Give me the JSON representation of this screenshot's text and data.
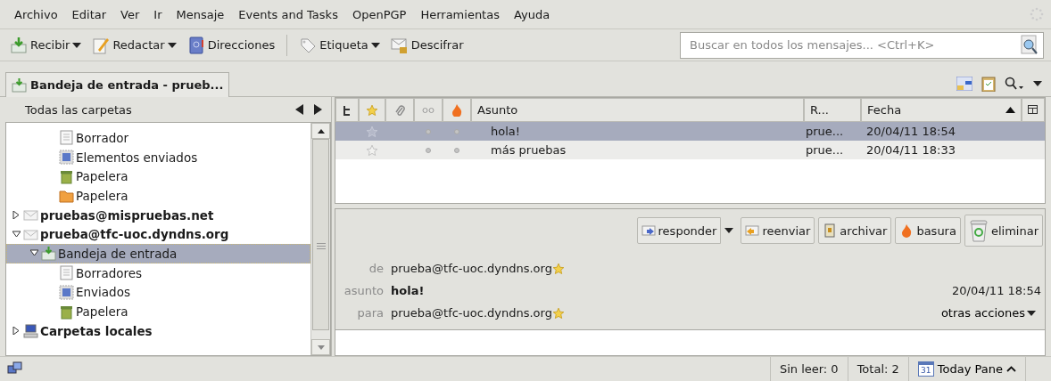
{
  "menu": [
    "Archivo",
    "Editar",
    "Ver",
    "Ir",
    "Mensaje",
    "Events and Tasks",
    "OpenPGP",
    "Herramientas",
    "Ayuda"
  ],
  "toolbar": [
    {
      "kind": "get",
      "label": "Recibir",
      "dropdown": true
    },
    {
      "kind": "write",
      "label": "Redactar",
      "dropdown": true
    },
    {
      "kind": "address",
      "label": "Direcciones",
      "dropdown": false
    },
    {
      "kind": "tag",
      "label": "Etiqueta",
      "dropdown": true
    },
    {
      "kind": "decrypt",
      "label": "Descifrar",
      "dropdown": false
    }
  ],
  "search": {
    "placeholder": "Buscar en todos los mensajes... <Ctrl+K>"
  },
  "tabs": [
    {
      "label": "Bandeja de entrada - prueb...",
      "selected": true
    }
  ],
  "folder_pane": {
    "header": "Todas las carpetas",
    "tree": [
      {
        "children": [
          {
            "children": [
              {
                "kind": "drafts",
                "label": "Borrador",
                "selected": false
              },
              {
                "kind": "sent",
                "label": "Elementos enviados",
                "selected": false
              },
              {
                "kind": "trash",
                "label": "Papelera",
                "selected": false
              },
              {
                "kind": "folder",
                "label": "Papelera",
                "selected": false
              }
            ]
          }
        ]
      },
      {
        "kind": "account",
        "label": "pruebas@mispruebas.net",
        "expanded": false,
        "selected": false
      },
      {
        "kind": "account",
        "label": "prueba@tfc-uoc.dyndns.org",
        "expanded": true,
        "selected": false,
        "children": [
          {
            "kind": "inbox",
            "label": "Bandeja de entrada",
            "expanded": true,
            "selected": true,
            "children": [
              {
                "kind": "drafts",
                "label": "Borradores",
                "selected": false
              },
              {
                "kind": "sent",
                "label": "Enviados",
                "selected": false
              },
              {
                "kind": "trash",
                "label": "Papelera",
                "selected": false
              }
            ]
          }
        ]
      },
      {
        "kind": "local",
        "label": "Carpetas locales",
        "expanded": false,
        "selected": false
      }
    ]
  },
  "thread_pane": {
    "columns": [
      "Asunto",
      "R...",
      "Fecha"
    ],
    "rows": [
      {
        "subject": "hola!",
        "correspondent": "prue...",
        "date": "20/04/11 18:54",
        "selected": true
      },
      {
        "subject": "más pruebas",
        "correspondent": "prue...",
        "date": "20/04/11 18:33",
        "selected": false
      }
    ]
  },
  "message_actions": [
    {
      "kind": "reply",
      "label": "responder",
      "dropdown": true
    },
    {
      "kind": "forward",
      "label": "reenviar",
      "dropdown": false
    },
    {
      "kind": "archive",
      "label": "archivar",
      "dropdown": false
    },
    {
      "kind": "junk",
      "label": "basura",
      "dropdown": false
    },
    {
      "kind": "delete",
      "label": "eliminar",
      "dropdown": false
    }
  ],
  "message_header": {
    "from_label": "de",
    "from": "prueba@tfc-uoc.dyndns.org",
    "subject_label": "asunto",
    "subject": "hola!",
    "date": "20/04/11 18:54",
    "to_label": "para",
    "to": "prueba@tfc-uoc.dyndns.org",
    "other_actions": "otras acciones"
  },
  "status_bar": {
    "unread": "Sin leer: 0",
    "total": "Total: 2",
    "today_pane": "Today Pane",
    "calendar_day": "31"
  }
}
